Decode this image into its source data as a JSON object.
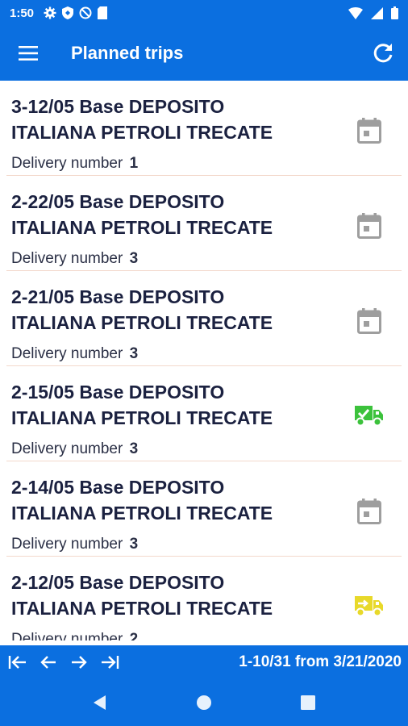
{
  "status_bar": {
    "time": "1:50",
    "icons": [
      "gear-icon",
      "shield-icon",
      "no-disturb-icon",
      "sim-card-icon",
      "wifi-icon",
      "signal-icon",
      "battery-icon"
    ]
  },
  "app_bar": {
    "title": "Planned trips",
    "menu_icon": "hamburger-icon",
    "refresh_icon": "refresh-icon"
  },
  "trips": [
    {
      "title_line1": "3-12/05 Base DEPOSITO",
      "title_line2": "ITALIANA PETROLI TRECATE",
      "delivery_label": "Delivery number",
      "delivery_number": "1",
      "status_icon": "calendar-icon",
      "status_color": "#9e9e9e"
    },
    {
      "title_line1": "2-22/05 Base DEPOSITO",
      "title_line2": "ITALIANA PETROLI TRECATE",
      "delivery_label": "Delivery number",
      "delivery_number": "3",
      "status_icon": "calendar-icon",
      "status_color": "#9e9e9e"
    },
    {
      "title_line1": "2-21/05 Base DEPOSITO",
      "title_line2": "ITALIANA PETROLI TRECATE",
      "delivery_label": "Delivery number",
      "delivery_number": "3",
      "status_icon": "calendar-icon",
      "status_color": "#9e9e9e"
    },
    {
      "title_line1": "2-15/05 Base DEPOSITO",
      "title_line2": "ITALIANA PETROLI TRECATE",
      "delivery_label": "Delivery number",
      "delivery_number": "3",
      "status_icon": "truck-check-icon",
      "status_color": "#3cc23c"
    },
    {
      "title_line1": "2-14/05 Base DEPOSITO",
      "title_line2": "ITALIANA PETROLI TRECATE",
      "delivery_label": "Delivery number",
      "delivery_number": "3",
      "status_icon": "calendar-icon",
      "status_color": "#9e9e9e"
    },
    {
      "title_line1": "2-12/05 Base DEPOSITO",
      "title_line2": "ITALIANA PETROLI TRECATE",
      "delivery_label": "Delivery number",
      "delivery_number": "2",
      "status_icon": "truck-arrow-icon",
      "status_color": "#e8d92a"
    }
  ],
  "pager": {
    "first_icon": "first-page-icon",
    "prev_icon": "arrow-left-icon",
    "next_icon": "arrow-right-icon",
    "last_icon": "last-page-icon",
    "info": "1-10/31 from 3/21/2020"
  },
  "nav_bar": {
    "back_icon": "back-triangle-icon",
    "home_icon": "home-circle-icon",
    "recents_icon": "recents-square-icon"
  },
  "colors": {
    "primary": "#0b6fe0",
    "title_text": "#1b2140",
    "divider": "#f3d9cc"
  }
}
